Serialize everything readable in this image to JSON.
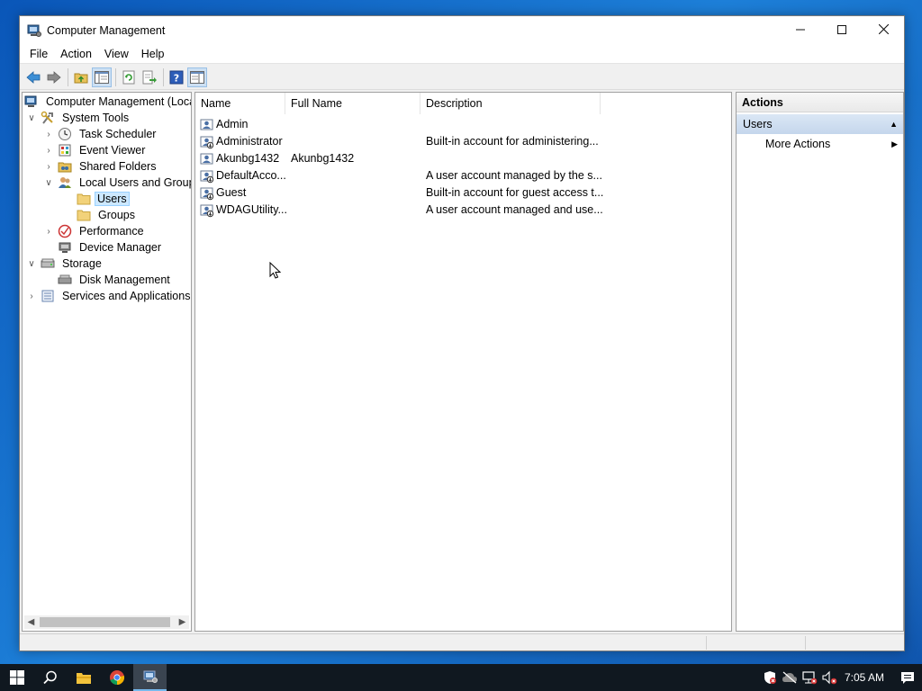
{
  "window": {
    "title": "Computer Management",
    "minimize_icon": "minimize-icon",
    "maximize_icon": "maximize-icon",
    "close_icon": "close-icon"
  },
  "menu": [
    "File",
    "Action",
    "View",
    "Help"
  ],
  "tree": {
    "root": "Computer Management (Local",
    "system_tools": "System Tools",
    "task_scheduler": "Task Scheduler",
    "event_viewer": "Event Viewer",
    "shared_folders": "Shared Folders",
    "local_users_groups": "Local Users and Groups",
    "users": "Users",
    "groups": "Groups",
    "performance": "Performance",
    "device_manager": "Device Manager",
    "storage": "Storage",
    "disk_management": "Disk Management",
    "services_apps": "Services and Applications"
  },
  "list": {
    "columns": [
      "Name",
      "Full Name",
      "Description"
    ],
    "rows": [
      {
        "name": "Admin",
        "full_name": "",
        "description": ""
      },
      {
        "name": "Administrator",
        "full_name": "",
        "description": "Built-in account for administering..."
      },
      {
        "name": "Akunbg1432",
        "full_name": "Akunbg1432",
        "description": ""
      },
      {
        "name": "DefaultAcco...",
        "full_name": "",
        "description": "A user account managed by the s..."
      },
      {
        "name": "Guest",
        "full_name": "",
        "description": "Built-in account for guest access t..."
      },
      {
        "name": "WDAGUtility...",
        "full_name": "",
        "description": "A user account managed and use..."
      }
    ]
  },
  "actions": {
    "title": "Actions",
    "section": "Users",
    "more_actions": "More Actions"
  },
  "taskbar": {
    "clock": "7:05 AM"
  },
  "colors": {
    "selection": "#cce8ff",
    "actions_section": "#c4d6ec",
    "taskbar": "#101820"
  }
}
